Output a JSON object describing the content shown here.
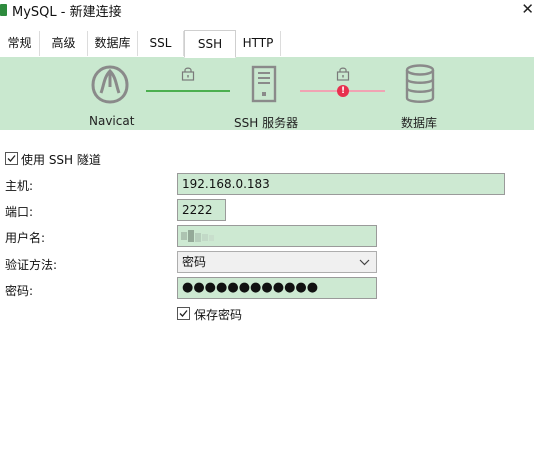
{
  "window": {
    "title": "MySQL - 新建连接"
  },
  "tabs": [
    {
      "label": "常规"
    },
    {
      "label": "高级"
    },
    {
      "label": "数据库"
    },
    {
      "label": "SSL"
    },
    {
      "label": "SSH",
      "active": true
    },
    {
      "label": "HTTP"
    }
  ],
  "diagram": {
    "nodes": [
      {
        "label": "Navicat",
        "icon": "navicat-logo-icon"
      },
      {
        "label": "SSH 服务器",
        "icon": "server-icon"
      },
      {
        "label": "数据库",
        "icon": "database-icon"
      }
    ],
    "links": [
      {
        "icon": "lock-icon",
        "status": "ok",
        "color": "#4caf50"
      },
      {
        "icon": "lock-icon",
        "status": "error",
        "color": "#e8304e",
        "badge": "!"
      }
    ]
  },
  "ssh": {
    "use_tunnel_label": "使用 SSH 隧道",
    "use_tunnel_checked": true,
    "host_label": "主机:",
    "host_value": "192.168.0.183",
    "port_label": "端口:",
    "port_value": "2222",
    "username_label": "用户名:",
    "username_value": "",
    "auth_label": "验证方法:",
    "auth_value": "密码",
    "password_label": "密码:",
    "password_value": "●●●●●●●●●●●●",
    "save_password_label": "保存密码",
    "save_password_checked": true
  },
  "colors": {
    "panel": "#c9e8cf",
    "field": "#cde9d2",
    "ok": "#4caf50",
    "error": "#e8304e"
  }
}
